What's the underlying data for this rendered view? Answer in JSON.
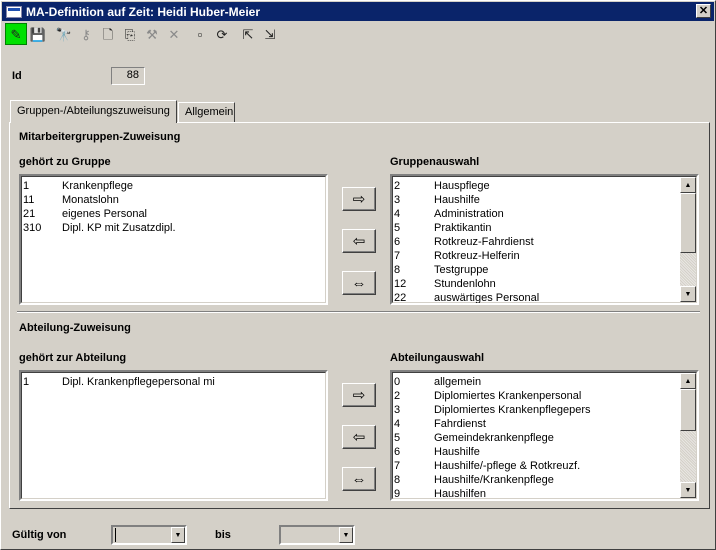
{
  "window": {
    "title": "MA-Definition auf Zeit: Heidi Huber-Meier",
    "close_glyph": "✕"
  },
  "toolbar": {
    "buttons": [
      {
        "icon": "pencil-icon",
        "glyph": "✎"
      },
      {
        "icon": "save-icon",
        "glyph": "💾"
      },
      {
        "icon": "binoculars-icon",
        "glyph": "🔭"
      },
      {
        "icon": "key-icon",
        "glyph": "⚷"
      },
      {
        "icon": "new-document-icon",
        "glyph": "🗋"
      },
      {
        "icon": "copy-icon",
        "glyph": "⎘"
      },
      {
        "icon": "tools-icon",
        "glyph": "⚒"
      },
      {
        "icon": "delete-icon",
        "glyph": "✕"
      },
      {
        "icon": "window-icon",
        "glyph": "▫"
      },
      {
        "icon": "refresh-icon",
        "glyph": "⟳"
      },
      {
        "icon": "expand-icon",
        "glyph": "⇱"
      },
      {
        "icon": "fit-icon",
        "glyph": "⇲"
      }
    ]
  },
  "id_field": {
    "label": "Id",
    "value": "88"
  },
  "tabs": [
    {
      "label": "Gruppen-/Abteilungszuweisung",
      "selected": true
    },
    {
      "label": "Allgemein",
      "selected": false
    }
  ],
  "groups": {
    "section_title": "Mitarbeitergruppen-Zuweisung",
    "assigned_label": "gehört zu Gruppe",
    "available_label": "Gruppenauswahl",
    "assigned": [
      {
        "id": "1",
        "name": "Krankenpflege"
      },
      {
        "id": "11",
        "name": "Monatslohn"
      },
      {
        "id": "21",
        "name": "eigenes Personal"
      },
      {
        "id": "310",
        "name": "Dipl. KP mit Zusatzdipl."
      }
    ],
    "available": [
      {
        "id": "2",
        "name": "Hauspflege"
      },
      {
        "id": "3",
        "name": "Haushilfe"
      },
      {
        "id": "4",
        "name": "Administration"
      },
      {
        "id": "5",
        "name": "Praktikantin"
      },
      {
        "id": "6",
        "name": "Rotkreuz-Fahrdienst"
      },
      {
        "id": "7",
        "name": "Rotkreuz-Helferin"
      },
      {
        "id": "8",
        "name": "Testgruppe"
      },
      {
        "id": "12",
        "name": "Stundenlohn"
      },
      {
        "id": "22",
        "name": "auswärtiges Personal"
      }
    ]
  },
  "departments": {
    "section_title": "Abteilung-Zuweisung",
    "assigned_label": "gehört zur Abteilung",
    "available_label": "Abteilungauswahl",
    "assigned": [
      {
        "id": "1",
        "name": "Dipl. Krankenpflegepersonal mi"
      }
    ],
    "available": [
      {
        "id": "0",
        "name": "allgemein"
      },
      {
        "id": "2",
        "name": "Diplomiertes Krankenpersonal"
      },
      {
        "id": "3",
        "name": "Diplomiertes Krankenpflegepers"
      },
      {
        "id": "4",
        "name": "Fahrdienst"
      },
      {
        "id": "5",
        "name": "Gemeindekrankenpflege"
      },
      {
        "id": "6",
        "name": "Haushilfe"
      },
      {
        "id": "7",
        "name": "Haushilfe/-pflege & Rotkreuzf."
      },
      {
        "id": "8",
        "name": "Haushilfe/Krankenpflege"
      },
      {
        "id": "9",
        "name": "Haushilfen"
      }
    ]
  },
  "move_buttons": {
    "add": "⇨",
    "remove": "⇦",
    "swap": "⇔"
  },
  "validity": {
    "from_label": "Gültig von",
    "to_label": "bis",
    "from_value": "",
    "to_value": ""
  }
}
